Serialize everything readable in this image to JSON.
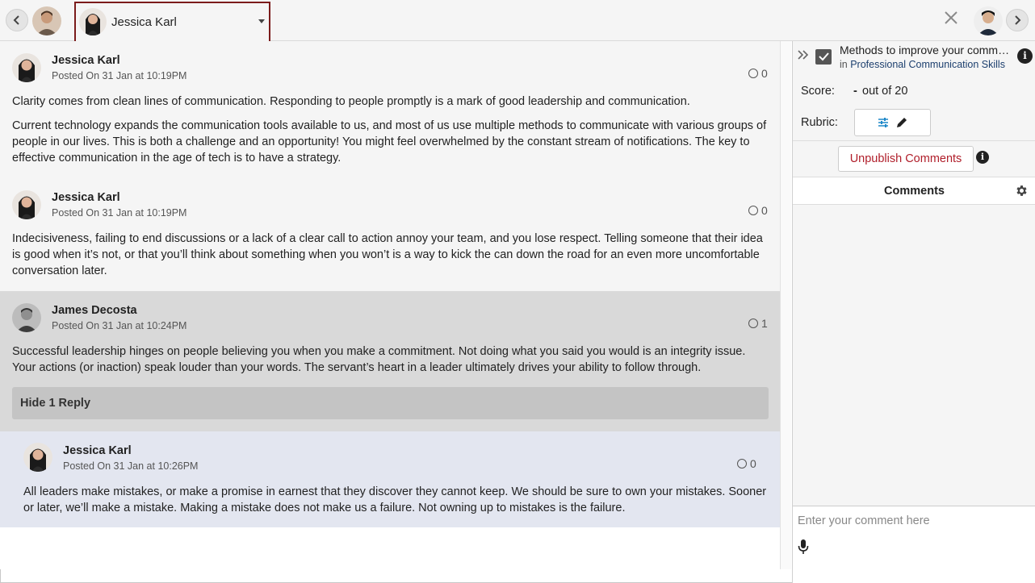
{
  "topbar": {
    "prev_icon": "chevron-left-icon",
    "next_icon": "chevron-right-icon",
    "selected_user": "Jessica Karl",
    "close_icon": "close-icon"
  },
  "posts": [
    {
      "author": "Jessica Karl",
      "date": "Posted On 31 Jan at 10:19PM",
      "reactions": "0",
      "paragraphs": [
        "Clarity comes from clean lines of communication. Responding to people promptly is a mark of good leadership and communication.",
        "Current technology expands the communication tools available to us, and most of us use multiple methods to communicate with various groups of people in our lives. This is both a challenge and an opportunity! You might feel overwhelmed by the constant stream of notifications. The key to effective communication in the age of tech is to have a strategy."
      ]
    },
    {
      "author": "Jessica Karl",
      "date": "Posted On 31 Jan at 10:19PM",
      "reactions": "0",
      "paragraphs": [
        "Indecisiveness, failing to end discussions or a lack of a clear call to action annoy your team, and you lose respect. Telling someone that their idea is good when it’s not, or that you’ll think about something when you won’t is a way to kick the can down the road for an even more uncomfortable conversation later."
      ]
    },
    {
      "author": "James Decosta",
      "date": "Posted On 31 Jan at 10:24PM",
      "reactions": "1",
      "paragraphs": [
        "Successful leadership hinges on people believing you when you make a commitment. Not doing what you said you would is an integrity issue. Your actions (or inaction) speak louder than your words. The servant’s heart in a leader ultimately drives your ability to follow through."
      ],
      "replies_toggle": "Hide 1 Reply"
    },
    {
      "author": "Jessica Karl",
      "date": "Posted On 31 Jan at 10:26PM",
      "reactions": "0",
      "paragraphs": [
        "All leaders make mistakes, or make a promise in earnest that they discover they cannot keep. We should be sure to own your mistakes. Sooner or later, we’ll make a mistake. Making a mistake does not make us a failure. Not owning up to mistakes is the failure."
      ]
    }
  ],
  "panel": {
    "task_title": "Methods to improve your communication",
    "task_in": "in",
    "task_course": "Professional Communication Skills",
    "score_label": "Score:",
    "score_value": "-",
    "score_out_of": "out of 20",
    "rubric_label": "Rubric:",
    "unpublish_label": "Unpublish Comments",
    "comments_title": "Comments",
    "comment_placeholder": "Enter your comment here"
  },
  "colors": {
    "highlight_border": "#7b1b1b",
    "reply_bg": "#e3e6f0",
    "selected_post_bg": "#d9d9d9",
    "unpublish_text": "#b01e2a",
    "link": "#1c3f6e",
    "rubric_icon": "#1e88c8"
  }
}
